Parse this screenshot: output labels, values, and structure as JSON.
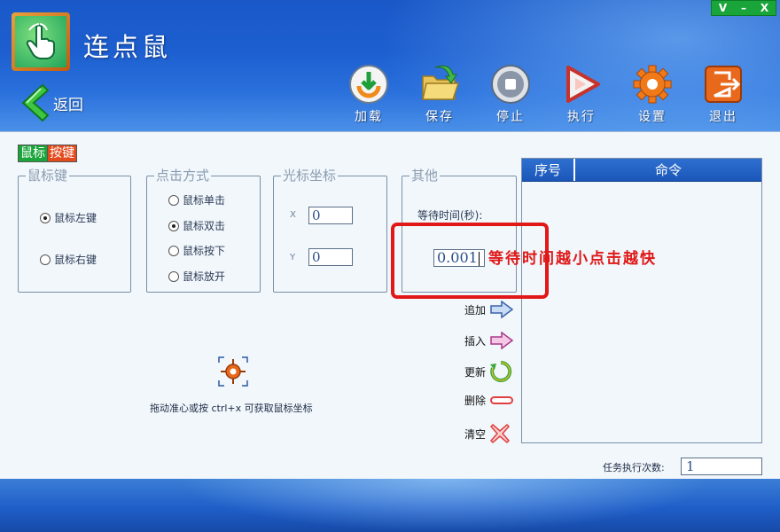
{
  "app": {
    "title": "连点鼠"
  },
  "window_controls": {
    "restore": "V",
    "minimize": "–",
    "close": "X"
  },
  "nav": {
    "back_label": "返回"
  },
  "toolbar": [
    {
      "id": "load",
      "label": "加载",
      "icon": "load-icon"
    },
    {
      "id": "save",
      "label": "保存",
      "icon": "save-folder-icon"
    },
    {
      "id": "stop",
      "label": "停止",
      "icon": "stop-icon"
    },
    {
      "id": "run",
      "label": "执行",
      "icon": "play-icon"
    },
    {
      "id": "settings",
      "label": "设置",
      "icon": "gear-icon"
    },
    {
      "id": "exit",
      "label": "退出",
      "icon": "exit-icon"
    }
  ],
  "tabs": {
    "mouse": "鼠标",
    "key": "按键"
  },
  "mouse_key": {
    "legend": "鼠标键",
    "left": "鼠标左键",
    "right": "鼠标右键",
    "selected": "left"
  },
  "click_mode": {
    "legend": "点击方式",
    "options": [
      "鼠标单击",
      "鼠标双击",
      "鼠标按下",
      "鼠标放开"
    ],
    "selected": 1
  },
  "cursor_coords": {
    "legend": "光标坐标",
    "x_label": "X",
    "x_value": "0",
    "y_label": "Y",
    "y_value": "0"
  },
  "other": {
    "legend": "其他",
    "wait_label": "等待时间(秒):",
    "wait_value": "0.001"
  },
  "annotation": {
    "text": "等待时间越小点击越快",
    "color": "#e01818"
  },
  "actions": [
    {
      "label": "追加",
      "icon": "arrow-right-blue-icon"
    },
    {
      "label": "插入",
      "icon": "arrow-right-pink-icon"
    },
    {
      "label": "更新",
      "icon": "refresh-icon"
    },
    {
      "label": "删除",
      "icon": "minus-icon"
    },
    {
      "label": "清空",
      "icon": "clear-x-icon"
    }
  ],
  "command_table": {
    "col_seq": "序号",
    "col_cmd": "命令",
    "rows": []
  },
  "drag_hint": "拖动准心或按 ctrl+x 可获取鼠标坐标",
  "task": {
    "label": "任务执行次数:",
    "value": "1"
  },
  "colors": {
    "header_blue": "#1d5fd0",
    "content_bg": "#f1f7fb",
    "tab_green": "#1aa53a",
    "tab_red": "#e34a1c",
    "window_ctrl_green": "#1aa53a"
  }
}
